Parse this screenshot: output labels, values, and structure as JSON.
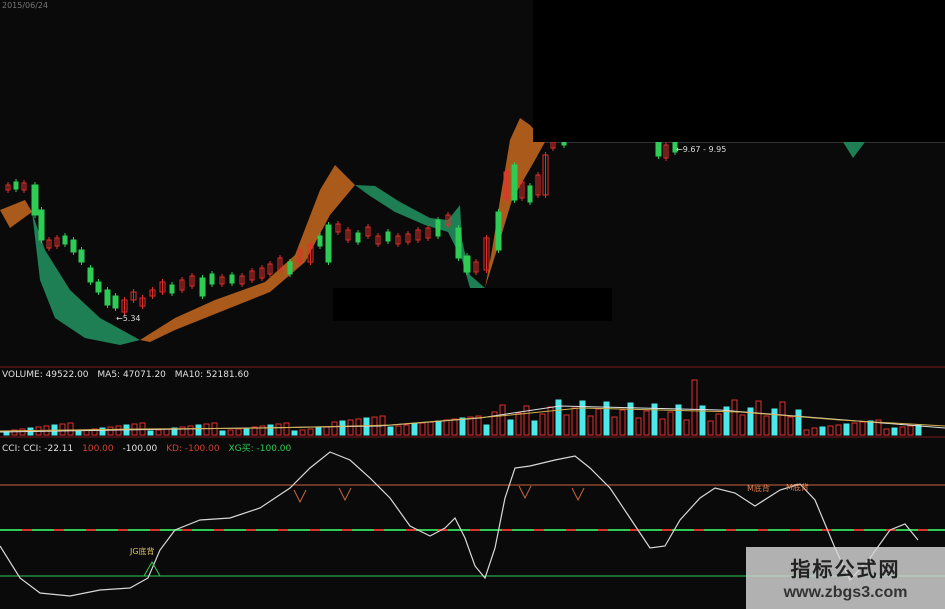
{
  "top_info": "2015/06/24",
  "price_panel": {
    "low_label": "←5.34",
    "range_label": "←9.67 - 9.95"
  },
  "volume_header": {
    "volume": "VOLUME: 49522.00",
    "ma5": "MA5: 47071.20",
    "ma10": "MA10: 52181.60"
  },
  "cci_header": {
    "cci": "CCI: CCI: -22.11",
    "v1": "100.00",
    "v2": "-100.00",
    "v3": "KD: -100.00",
    "v4": "XG买: -100.00"
  },
  "cci_labels": {
    "jg": "JG底背",
    "m1": "M底背",
    "m2": "M底背"
  },
  "watermark": {
    "title": "指标公式网",
    "url": "www.zbgs3.com"
  },
  "colors": {
    "up": "#e0302b",
    "down": "#2ecc55",
    "ribbon_up": "#b8631d",
    "ribbon_down": "#1f8a5a",
    "volume_down": "#4de8e8",
    "cci_line": "#d8d8d8",
    "ref_line": "#c8643c",
    "zero_line": "#2ecc55"
  }
}
